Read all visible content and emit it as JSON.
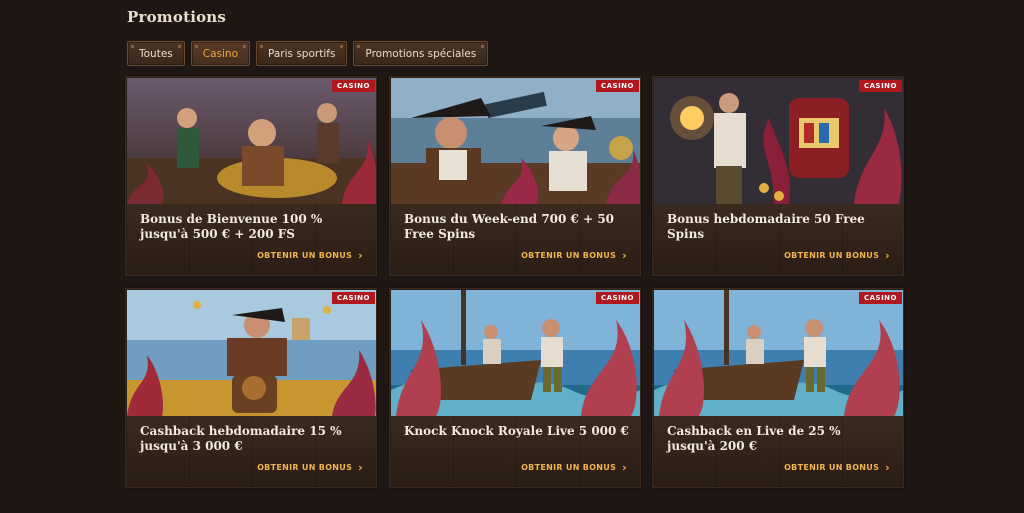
{
  "page_title": "Promotions",
  "tabs": [
    {
      "label": "Toutes"
    },
    {
      "label": "Casino"
    },
    {
      "label": "Paris sportifs"
    },
    {
      "label": "Promotions spéciales"
    }
  ],
  "active_tab": "Casino",
  "accent_color": "#f0a33a",
  "badge_color": "#b0181e",
  "cards": [
    {
      "badge": "CASINO",
      "title": "Bonus de Bienvenue 100 % jusqu'à 500 € + 200 FS",
      "cta": "OBTENIR UN BONUS",
      "image": "pirate-crew-treasure-illustration"
    },
    {
      "badge": "CASINO",
      "title": "Bonus du Week-end 700 € + 50 Free Spins",
      "cta": "OBTENIR UN BONUS",
      "image": "pirate-captain-and-lady-illustration"
    },
    {
      "badge": "CASINO",
      "title": "Bonus hebdomadaire 50 Free Spins",
      "cta": "OBTENIR UN BONUS",
      "image": "pirate-lantern-slot-machine-illustration"
    },
    {
      "badge": "CASINO",
      "title": "Cashback hebdomadaire 15 % jusqu'à 3 000 €",
      "cta": "OBTENIR UN BONUS",
      "image": "pirate-king-on-barrel-illustration"
    },
    {
      "badge": "CASINO",
      "title": "Knock Knock Royale Live 5 000 €",
      "cta": "OBTENIR UN BONUS",
      "image": "kraken-attacking-ship-illustration"
    },
    {
      "badge": "CASINO",
      "title": "Cashback en Live de 25 % jusqu'à 200 €",
      "cta": "OBTENIR UN BONUS",
      "image": "kraken-attacking-ship-illustration"
    }
  ]
}
